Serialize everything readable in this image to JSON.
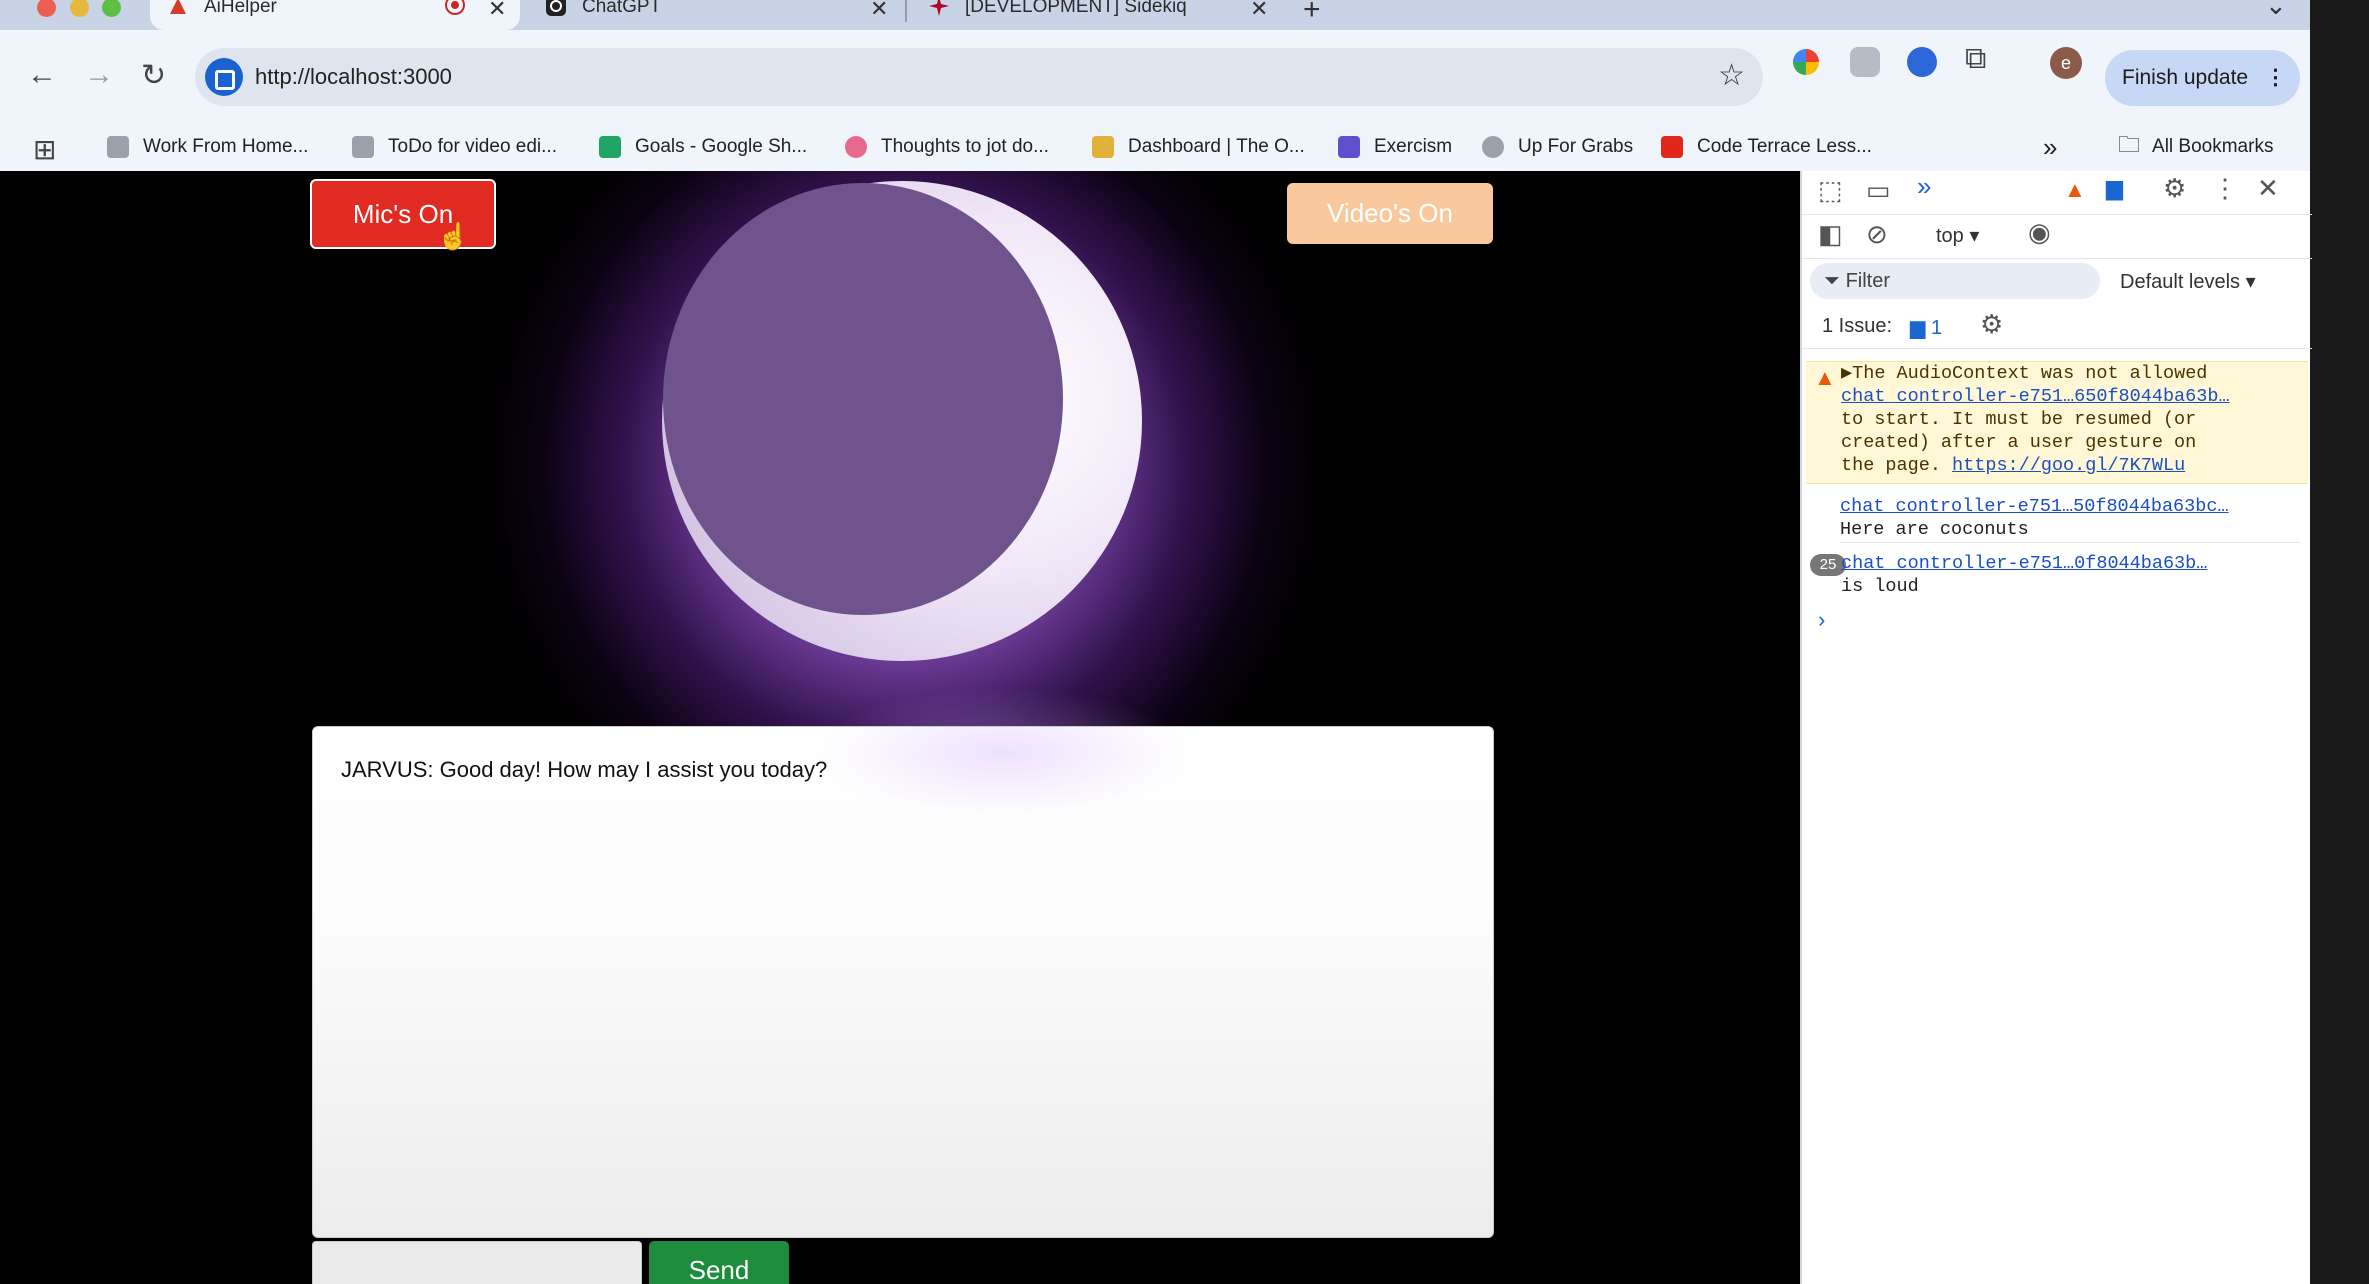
{
  "browser": {
    "tabs": [
      {
        "title": "AiHelper",
        "active": true,
        "close": "✕"
      },
      {
        "title": "ChatGPT",
        "active": false,
        "close": "✕"
      },
      {
        "title": "[DEVELOPMENT] Sidekiq",
        "active": false,
        "close": "✕"
      }
    ],
    "new_tab": "+",
    "url": "http://localhost:3000",
    "finish_update": "Finish update",
    "profile_initial": "e",
    "bookmarks": [
      {
        "label": "Work From Home...",
        "icon_color": "#9aa1ab"
      },
      {
        "label": "ToDo for video edi...",
        "icon_color": "#9aa1ab"
      },
      {
        "label": "Goals - Google Sh...",
        "icon_color": "#1fa463"
      },
      {
        "label": "Thoughts to jot do...",
        "icon_color": "#e8698e"
      },
      {
        "label": "Dashboard | The O...",
        "icon_color": "#e0b23a"
      },
      {
        "label": "Exercism",
        "icon_color": "#604fcd"
      },
      {
        "label": "Up For Grabs",
        "icon_color": "#9aa1ab"
      },
      {
        "label": "Code Terrace Less...",
        "icon_color": "#e1261c"
      }
    ],
    "bookmarks_overflow": "»",
    "all_bookmarks": "All Bookmarks"
  },
  "app": {
    "mic_button": "Mic's On",
    "video_button": "Video's On",
    "chat_message": "JARVUS: Good day! How may I assist you today?",
    "message_input_value": "",
    "send_button": "Send",
    "colors": {
      "mic": "#e02a22",
      "video": "#f9c89c",
      "send": "#1d8c3c",
      "moon": "#70538d"
    }
  },
  "devtools": {
    "context": "top ▾",
    "filter_placeholder": "Filter",
    "levels": "Default levels ▾",
    "issues_label": "1 Issue:",
    "issues_count": "1",
    "warning": {
      "prefix": "▶The AudioContext was not allowed",
      "link": "chat_controller-e751…650f8044ba63b…",
      "text": "to start. It must be resumed (or\ncreated) after a user gesture on\nthe page. ",
      "help_link": "https://goo.gl/7K7WLu"
    },
    "log1": {
      "link": "chat_controller-e751…50f8044ba63bc…",
      "text": "Here are coconuts"
    },
    "log2": {
      "count": "25",
      "link": "chat_controller-e751…0f8044ba63b…",
      "text": "is loud"
    },
    "prompt": "›"
  }
}
